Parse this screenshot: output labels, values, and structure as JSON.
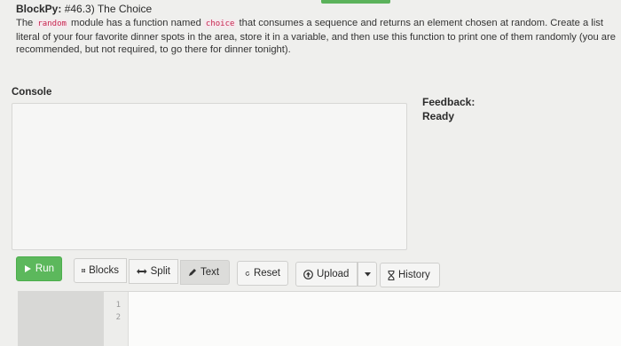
{
  "header": {
    "brand": "BlockPy:",
    "problem_title": "#46.3) The Choice",
    "description_part1": "The ",
    "code_module": "random",
    "description_part2": " module has a function named ",
    "code_function": "choice",
    "description_part3": " that consumes a sequence and returns an element chosen at random. Create a list literal of your four favorite dinner spots in the area, store it in a variable, and then use this function to print one of them randomly (you are recommended, but not required, to go there for dinner tonight)."
  },
  "console": {
    "label": "Console"
  },
  "feedback": {
    "label": "Feedback:",
    "status": "Ready"
  },
  "toolbar": {
    "run": "Run",
    "blocks": "Blocks",
    "split": "Split",
    "text": "Text",
    "reset": "Reset",
    "upload": "Upload",
    "history": "History"
  },
  "editor": {
    "line_numbers": [
      "1",
      "2"
    ]
  },
  "colors": {
    "run_green": "#5cb85c",
    "code_red": "#c7254e",
    "accent_green": "#5bb25b"
  },
  "icons": {
    "run": "play-icon",
    "blocks": "grid-icon",
    "split": "double-arrow-icon",
    "text": "pencil-icon",
    "reset": "refresh-icon",
    "upload": "upload-circle-icon",
    "upload_caret": "caret-down-icon",
    "history": "hourglass-icon"
  }
}
